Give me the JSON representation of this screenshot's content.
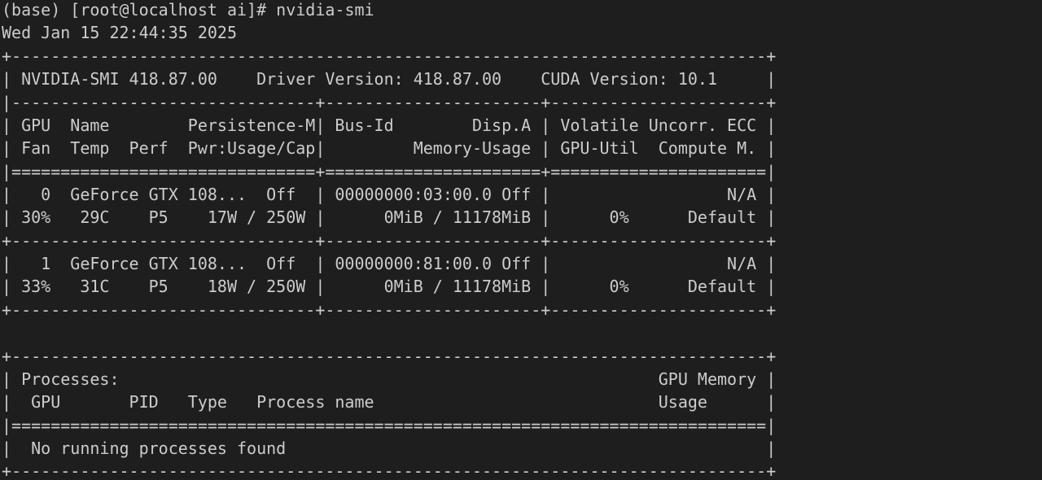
{
  "terminal": {
    "prompt": "(base) [root@localhost ai]# ",
    "command": "nvidia-smi",
    "timestamp": "Wed Jan 15 22:44:35 2025"
  },
  "smi": {
    "border_top": "+-----------------------------------------------------------------------------+",
    "version_line": "| NVIDIA-SMI 418.87.00    Driver Version: 418.87.00    CUDA Version: 10.1     |",
    "header_sep": "|-------------------------------+----------------------+----------------------+",
    "header_row1": "| GPU  Name        Persistence-M| Bus-Id        Disp.A | Volatile Uncorr. ECC |",
    "header_row2": "| Fan  Temp  Perf  Pwr:Usage/Cap|         Memory-Usage | GPU-Util  Compute M. |",
    "header_double": "|===============================+======================+======================|",
    "gpus": [
      {
        "row1": "|   0  GeForce GTX 108...  Off  | 00000000:03:00.0 Off |                  N/A |",
        "row2": "| 30%   29C    P5    17W / 250W |      0MiB / 11178MiB |      0%      Default |"
      },
      {
        "row1": "|   1  GeForce GTX 108...  Off  | 00000000:81:00.0 Off |                  N/A |",
        "row2": "| 33%   31C    P5    18W / 250W |      0MiB / 11178MiB |      0%      Default |"
      }
    ],
    "gpu_sep": "+-------------------------------+----------------------+----------------------+"
  },
  "processes": {
    "border": "+-----------------------------------------------------------------------------+",
    "title_line": "| Processes:                                                       GPU Memory |",
    "header_line": "|  GPU       PID   Type   Process name                             Usage      |",
    "double_line": "|=============================================================================|",
    "empty_line": "|  No running processes found                                                 |"
  }
}
